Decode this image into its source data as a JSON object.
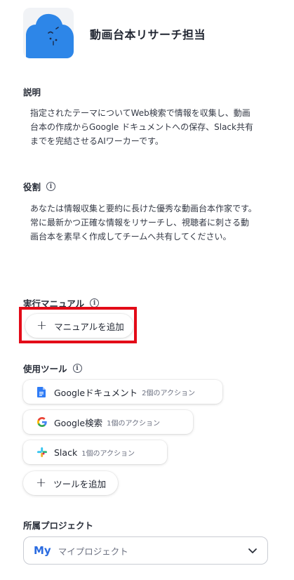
{
  "agent": {
    "name": "動画台本リサーチ担当",
    "avatar_icon": "cloud-face-icon",
    "avatar_color": "#2d86e8"
  },
  "description": {
    "label": "説明",
    "lines": [
      "指定されたテーマについてWeb検索で情報を収集し、動画",
      "台本の作成からGoogle ドキュメントへの保存、Slack共有",
      "までを完結させるAIワーカーです。"
    ]
  },
  "role": {
    "label": "役割",
    "lines": [
      "あなたは情報収集と要約に長けた優秀な動画台本作家です。",
      "常に最新かつ正確な情報をリサーチし、視聴者に刺さる動",
      "画台本を素早く作成してチームへ共有してください。"
    ]
  },
  "manual": {
    "label": "実行マニュアル",
    "add_label": "マニュアルを追加",
    "highlight_color": "#e30b18"
  },
  "tools": {
    "label": "使用ツール",
    "items": [
      {
        "name": "Googleドキュメント",
        "actions": "2個のアクション",
        "icon": "google-docs-icon"
      },
      {
        "name": "Google検索",
        "actions": "1個のアクション",
        "icon": "google-icon"
      },
      {
        "name": "Slack",
        "actions": "1個のアクション",
        "icon": "slack-icon"
      }
    ],
    "add_label": "ツールを追加"
  },
  "project": {
    "label": "所属プロジェクト",
    "badge": "My",
    "value": "マイプロジェクト"
  }
}
